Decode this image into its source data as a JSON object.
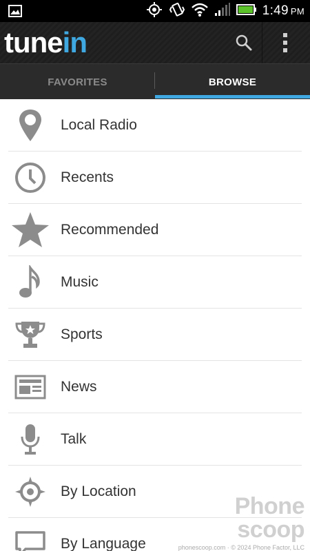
{
  "status_bar": {
    "time": "1:49",
    "ampm": "PM",
    "icons": [
      "image-icon",
      "gps-icon",
      "vibrate-icon",
      "wifi-icon",
      "signal-icon",
      "battery-icon"
    ]
  },
  "app_bar": {
    "brand_tune": "tune",
    "brand_in": "in",
    "icons": [
      "search-icon",
      "overflow-menu-icon"
    ]
  },
  "tabs": [
    {
      "label": "FAVORITES",
      "selected": false
    },
    {
      "label": "BROWSE",
      "selected": true
    }
  ],
  "colors": {
    "accent": "#3fa8e0",
    "icon_gray": "#8c8c8c",
    "text": "#333333"
  },
  "browse_items": [
    {
      "label": "Local Radio",
      "icon": "location-pin-icon"
    },
    {
      "label": "Recents",
      "icon": "clock-icon"
    },
    {
      "label": "Recommended",
      "icon": "star-icon"
    },
    {
      "label": "Music",
      "icon": "music-note-icon"
    },
    {
      "label": "Sports",
      "icon": "trophy-icon"
    },
    {
      "label": "News",
      "icon": "newspaper-icon"
    },
    {
      "label": "Talk",
      "icon": "microphone-icon"
    },
    {
      "label": "By Location",
      "icon": "compass-icon"
    },
    {
      "label": "By Language",
      "icon": "speech-bubble-icon"
    }
  ],
  "watermark": {
    "line1": "Phone",
    "line2": "scoop",
    "credit": "phonescoop.com · © 2024 Phone Factor, LLC"
  }
}
